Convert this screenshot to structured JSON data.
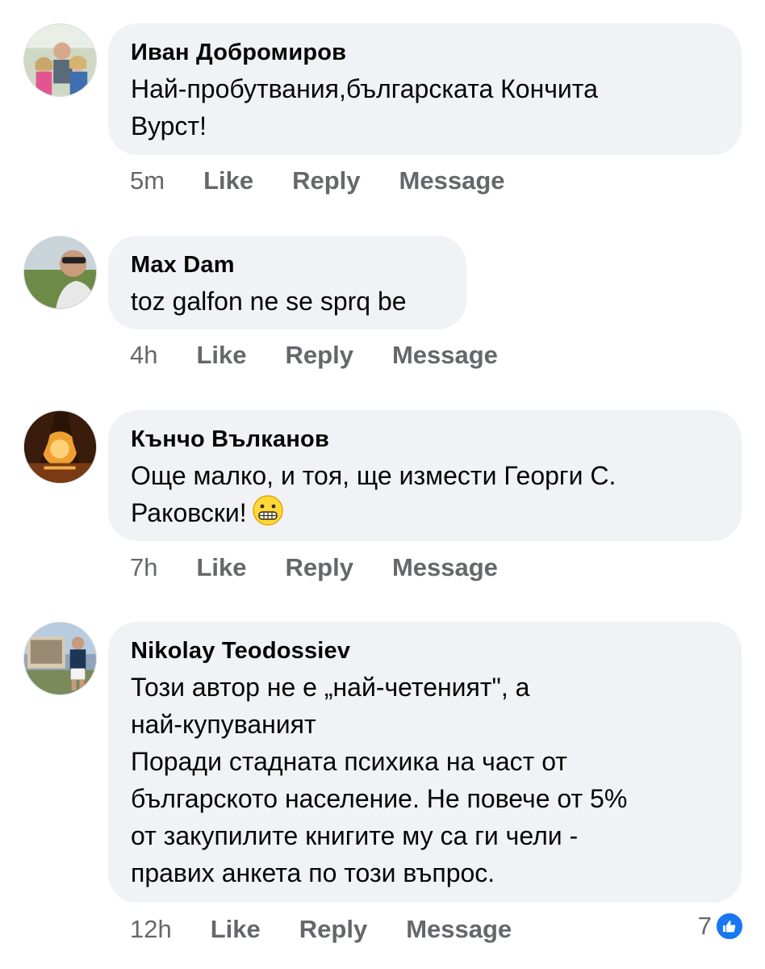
{
  "comments": [
    {
      "author": "Иван Добромиров",
      "text": "Най-пробутвания,българската Кончита\nВурст!",
      "time": "5m",
      "actions": {
        "like": "Like",
        "reply": "Reply",
        "message": "Message"
      }
    },
    {
      "author": "Max Dam",
      "text": "toz galfon ne se sprq be",
      "time": "4h",
      "actions": {
        "like": "Like",
        "reply": "Reply",
        "message": "Message"
      }
    },
    {
      "author": "Кънчо Вълканов",
      "text": "Още малко, и тоя, ще измести Георги С.\nРаковски!",
      "emoji": "grimacing-face",
      "time": "7h",
      "actions": {
        "like": "Like",
        "reply": "Reply",
        "message": "Message"
      }
    },
    {
      "author": "Nikolay Teodossiev",
      "text": "Този автор не е „най-четеният\", а\nнай-купуваният\nПоради стадната психика на част от\nбългарското население. Не повече от 5%\nот закупилите книгите му са ги чели -\nправих анкета по този въпрос.",
      "time": "12h",
      "actions": {
        "like": "Like",
        "reply": "Reply",
        "message": "Message"
      },
      "reaction_count": "7",
      "reaction_icon": "like-icon"
    }
  ],
  "colors": {
    "bubble": "#f0f2f5",
    "meta": "#65676b",
    "like_blue": "#1877f2"
  }
}
